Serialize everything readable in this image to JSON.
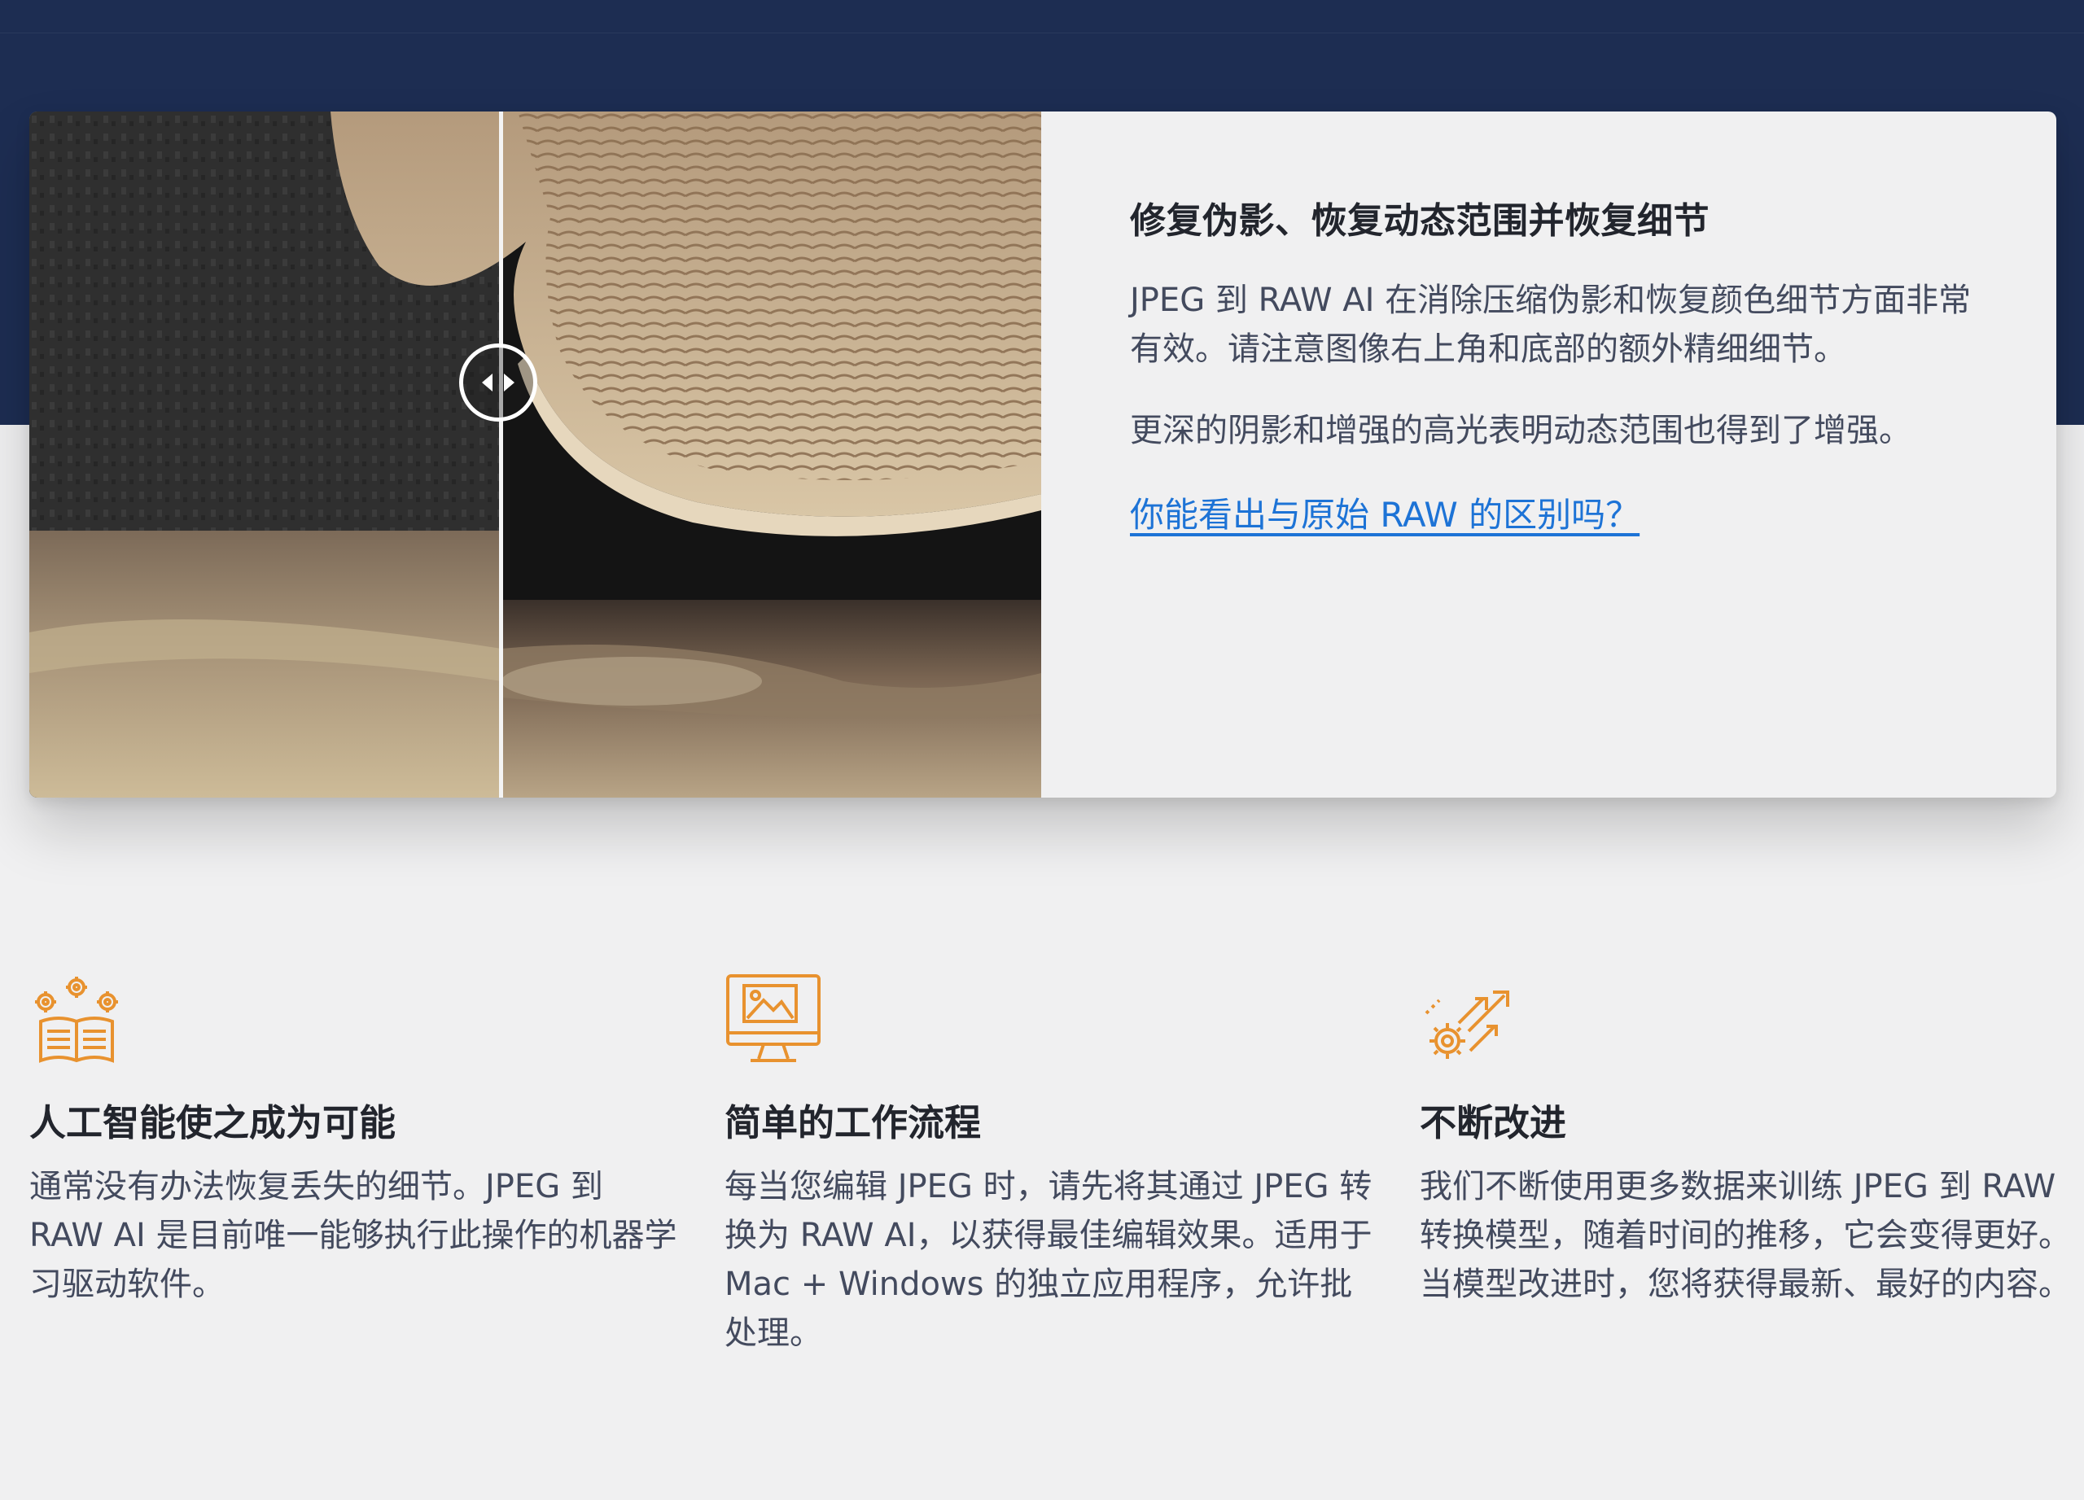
{
  "hero": {
    "heading": "修复伪影、恢复动态范围并恢复细节",
    "paragraph1": "JPEG 到 RAW AI 在消除压缩伪影和恢复颜色细节方面非常有效。请注意图像右上角和底部的额外精细细节。",
    "paragraph2": "更深的阴影和增强的高光表明动态范围也得到了增强。",
    "link": "你能看出与原始 RAW 的区别吗？"
  },
  "features": [
    {
      "icon": "gears-book-icon",
      "title": "人工智能使之成为可能",
      "description": "通常没有办法恢复丢失的细节。JPEG 到 RAW AI 是目前唯一能够执行此操作的机器学习驱动软件。"
    },
    {
      "icon": "monitor-image-icon",
      "title": "简单的工作流程",
      "description": "每当您编辑 JPEG 时，请先将其通过 JPEG 转换为 RAW AI，以获得最佳编辑效果。适用于 Mac + Windows 的独立应用程序，允许批处理。"
    },
    {
      "icon": "gear-arrows-icon",
      "title": "不断改进",
      "description": "我们不断使用更多数据来训练 JPEG 到 RAW 转换模型，随着时间的推移，它会变得更好。当模型改进时，您将获得最新、最好的内容。"
    }
  ],
  "colors": {
    "header_band": "#1d2d52",
    "background": "#f0f0f1",
    "link": "#1d73d6",
    "icon_orange": "#e8922f"
  }
}
